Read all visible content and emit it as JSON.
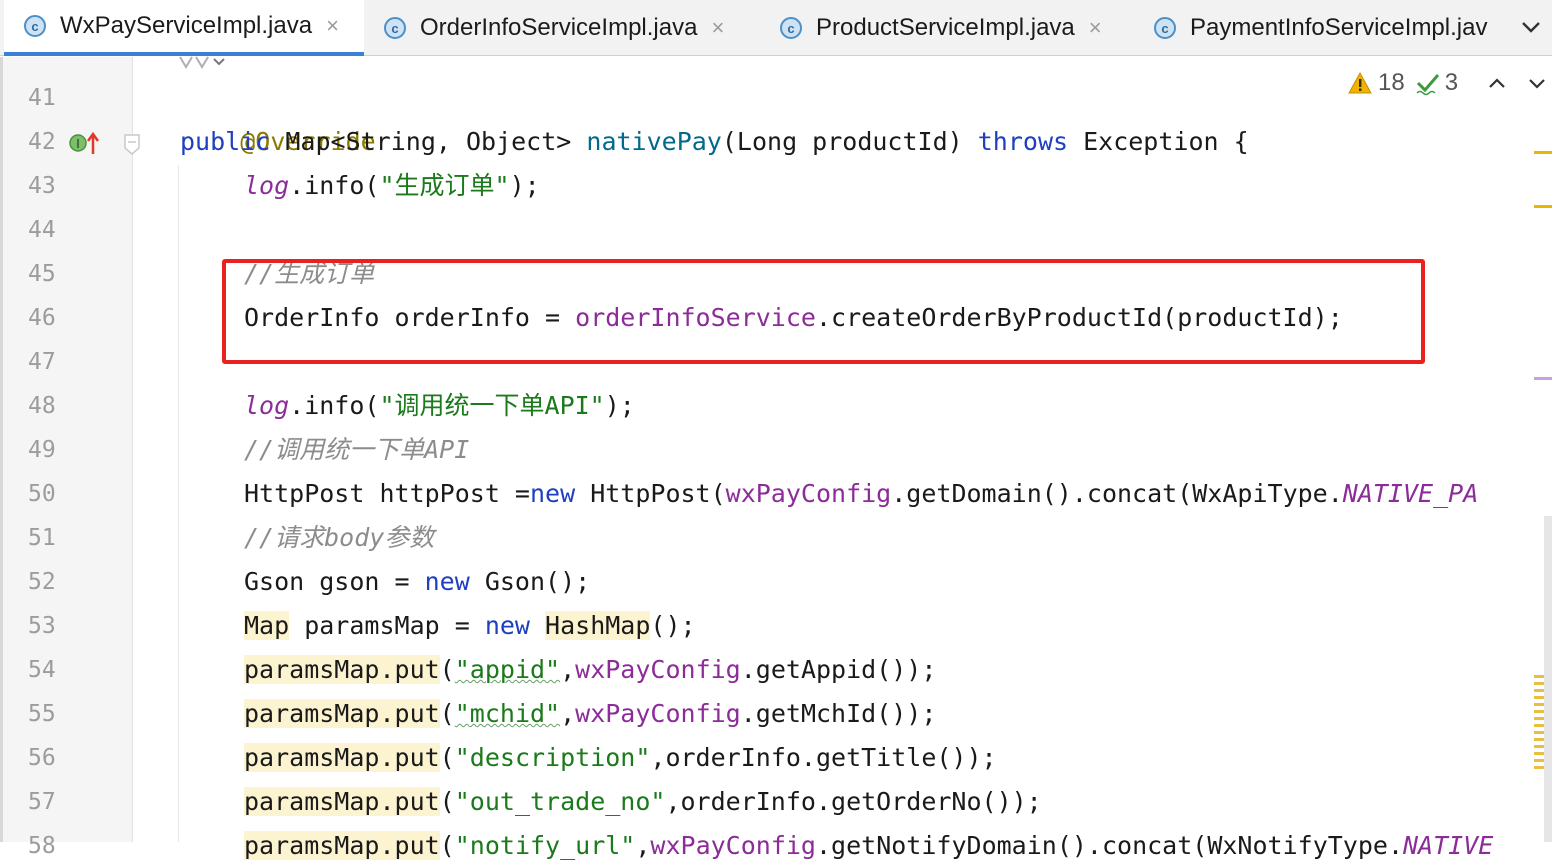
{
  "tabs": [
    {
      "label": "WxPayServiceImpl.java",
      "icon": "class-icon",
      "active": true
    },
    {
      "label": "OrderInfoServiceImpl.java",
      "icon": "class-icon",
      "active": false
    },
    {
      "label": "ProductServiceImpl.java",
      "icon": "class-icon",
      "active": false
    },
    {
      "label": "PaymentInfoServiceImpl.jav",
      "icon": "class-icon",
      "active": false
    }
  ],
  "icon_letter": "c",
  "close_glyph": "×",
  "inspections": {
    "warnings": "18",
    "ok": "3"
  },
  "line_numbers": [
    "41",
    "42",
    "43",
    "44",
    "45",
    "46",
    "47",
    "48",
    "49",
    "50",
    "51",
    "52",
    "53",
    "54",
    "55",
    "56",
    "57",
    "58"
  ],
  "code": {
    "l41_annotation": "@Override",
    "l42": {
      "public": "public",
      "type": " Map<String, Object> ",
      "method": "nativePay",
      "params": "(Long productId) ",
      "throws": "throws",
      "rest": " Exception {"
    },
    "l43": {
      "log": "log",
      "call": ".info(",
      "str": "\"生成订单\"",
      "end": ");"
    },
    "l45_comment": "//生成订单",
    "l46": {
      "decl": "OrderInfo orderInfo = ",
      "field": "orderInfoService",
      "call": ".createOrderByProductId(productId);"
    },
    "l48": {
      "log": "log",
      "call": ".info(",
      "str": "\"调用统一下单API\"",
      "end": ");"
    },
    "l49_comment": "//调用统一下单API",
    "l50": {
      "decl": "HttpPost httpPost =",
      "new": "new",
      "cls": " HttpPost(",
      "field": "wxPayConfig",
      "call": ".getDomain().concat(WxApiType.",
      "static": "NATIVE_PA"
    },
    "l51_comment": "//请求body参数",
    "l52": {
      "decl": "Gson gson = ",
      "new": "new",
      "rest": " Gson();"
    },
    "l53": {
      "map": "Map",
      "mid": " paramsMap = ",
      "new": "new",
      "sp": " ",
      "hashmap": "HashMap",
      "end": "();"
    },
    "l54": {
      "put": "paramsMap.put",
      "open": "(",
      "str": "\"appid\"",
      "comma": ",",
      "field": "wxPayConfig",
      "call": ".getAppid());"
    },
    "l55": {
      "put": "paramsMap.put",
      "open": "(",
      "str": "\"mchid\"",
      "comma": ",",
      "field": "wxPayConfig",
      "call": ".getMchId());"
    },
    "l56": {
      "put": "paramsMap.put",
      "open": "(",
      "str": "\"description\"",
      "call": ",orderInfo.getTitle());"
    },
    "l57": {
      "put": "paramsMap.put",
      "open": "(",
      "str": "\"out_trade_no\"",
      "call": ",orderInfo.getOrderNo());"
    },
    "l58": {
      "put": "paramsMap.put",
      "open": "(",
      "str": "\"notify_url\"",
      "comma": ",",
      "field": "wxPayConfig",
      "call": ".getNotifyDomain().concat(WxNotifyType.",
      "static": "NATIVE"
    }
  }
}
